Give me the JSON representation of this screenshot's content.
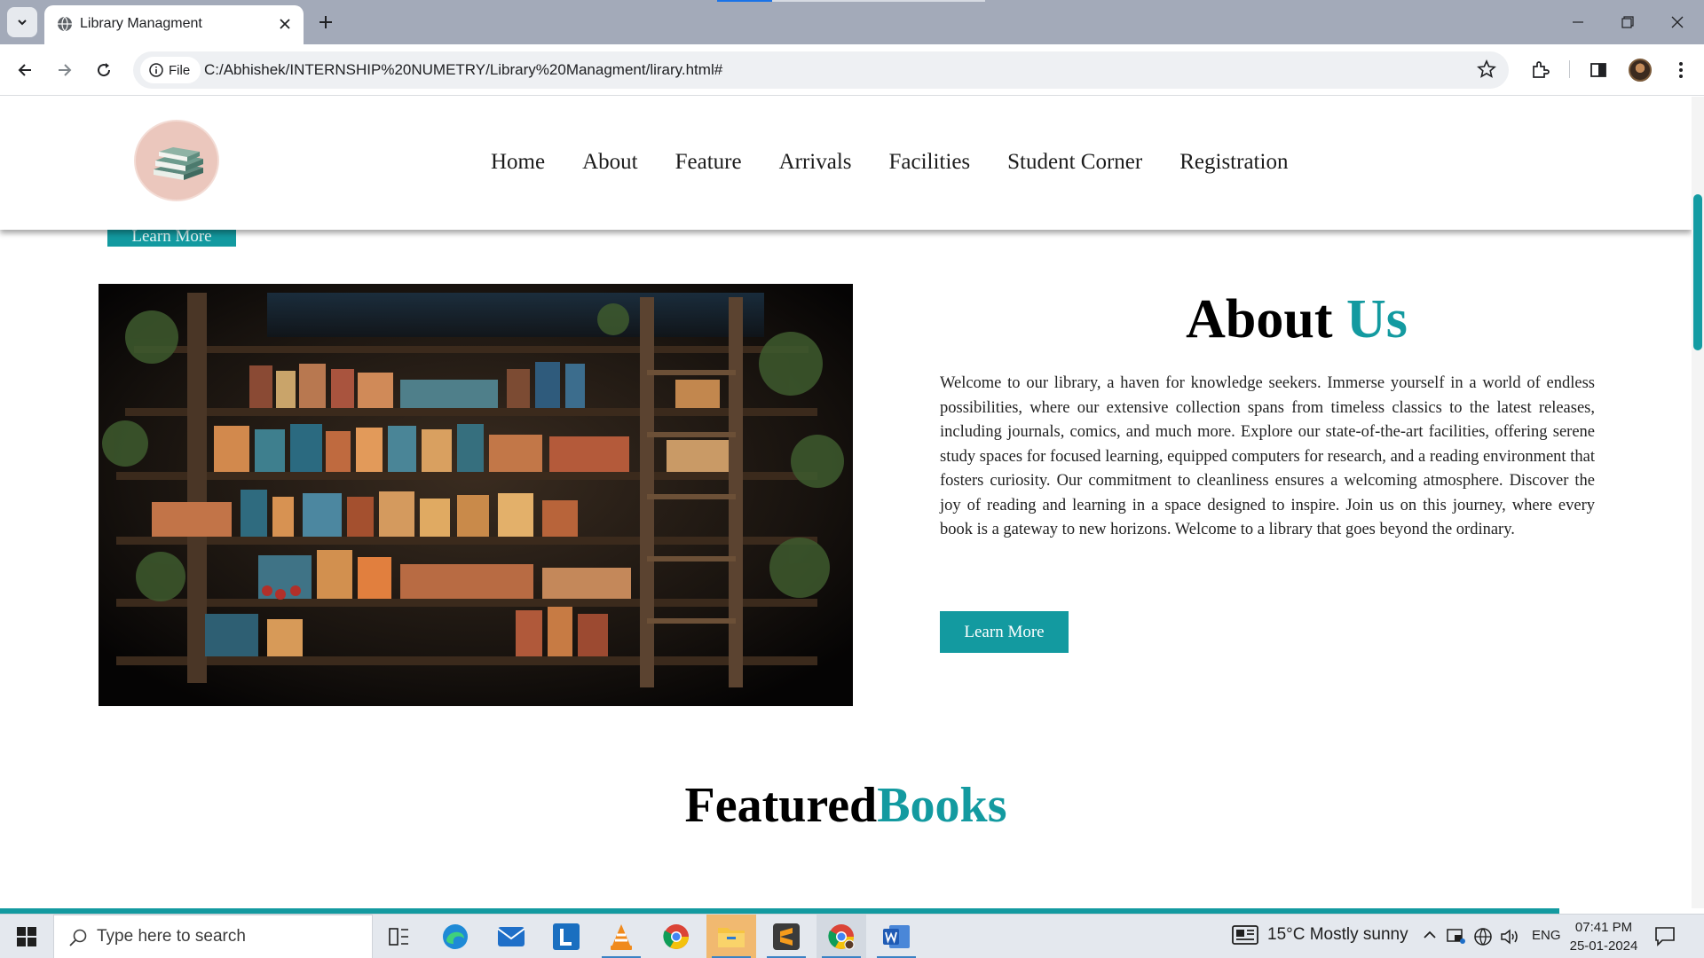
{
  "browser": {
    "tab_title": "Library Managment",
    "site_info_chip": "File",
    "url": "C:/Abhishek/INTERNSHIP%20NUMETRY/Library%20Managment/lirary.html#",
    "icons": [
      "tab-search-icon",
      "globe-icon",
      "close-icon",
      "plus-icon",
      "minimize-icon",
      "restore-icon",
      "close-window-icon",
      "back-arrow-icon",
      "forward-arrow-icon",
      "reload-icon",
      "info-icon",
      "star-icon",
      "extensions-icon",
      "side-panel-icon"
    ]
  },
  "site": {
    "nav": [
      "Home",
      "About",
      "Feature",
      "Arrivals",
      "Facilities",
      "Student Corner",
      "Registration"
    ],
    "partial_button": "Learn More",
    "about": {
      "title_main": "About",
      "title_accent": "Us",
      "paragraph": "Welcome to our library, a haven for knowledge seekers. Immerse yourself in a world of endless possibilities, where our extensive collection spans from timeless classics to the latest releases, including journals, comics, and much more. Explore our state-of-the-art facilities, offering serene study spaces for focused learning, equipped computers for research, and a reading environment that fosters curiosity. Our commitment to cleanliness ensures a welcoming atmosphere. Discover the joy of reading and learning in a space designed to inspire. Join us on this journey, where every book is a gateway to new horizons. Welcome to a library that goes beyond the ordinary.",
      "button": "Learn More"
    },
    "featured": {
      "title_main": "Featured",
      "title_accent": "Books"
    },
    "colors": {
      "accent": "#139aa0",
      "text": "#000000"
    }
  },
  "taskbar": {
    "search_placeholder": "Type here to search",
    "weather": "15°C  Mostly sunny",
    "language": "ENG",
    "time": "07:41 PM",
    "date": "25-01-2024",
    "apps": [
      "task-view-icon",
      "edge-icon",
      "mail-icon",
      "l-app-icon",
      "vlc-icon",
      "chrome-icon",
      "file-explorer-icon",
      "sublime-icon",
      "chrome-profile-icon",
      "word-icon"
    ]
  }
}
